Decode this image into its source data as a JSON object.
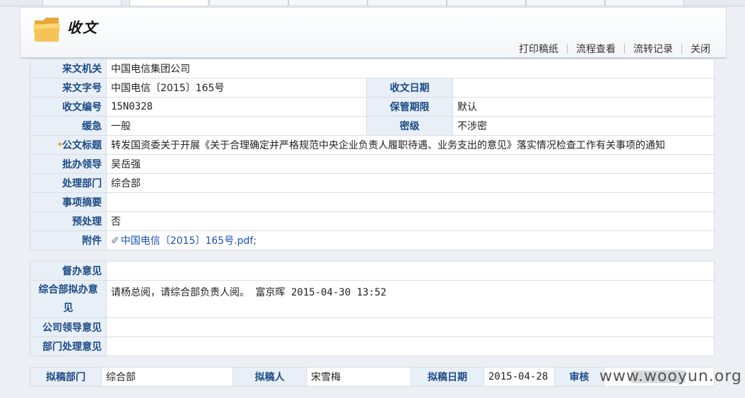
{
  "header": {
    "title": "收文",
    "actions": [
      "打印稿纸",
      "流程查看",
      "流转记录",
      "关闭"
    ]
  },
  "form": {
    "issuer": {
      "label": "来文机关",
      "value": "中国电信集团公司"
    },
    "doc_no": {
      "label": "来文字号",
      "value": "中国电信〔2015〕165号"
    },
    "recv_date": {
      "label": "收文日期",
      "value": ""
    },
    "recv_no": {
      "label": "收文编号",
      "value": "15N0328"
    },
    "retention": {
      "label": "保管期限",
      "value": "默认"
    },
    "urgency": {
      "label": "缓急",
      "value": "一般"
    },
    "secrecy": {
      "label": "密级",
      "value": "不涉密"
    },
    "subject": {
      "required_mark": "*",
      "label": "公文标题",
      "value": "转发国资委关于开展《关于合理确定并严格规范中央企业负责人履职待遇、业务支出的意见》落实情况检查工作有关事项的通知"
    },
    "leader": {
      "label": "批办领导",
      "value": "吴岳强"
    },
    "dept": {
      "label": "处理部门",
      "value": "综合部"
    },
    "summary": {
      "label": "事项摘要",
      "value": ""
    },
    "preprocess": {
      "label": "预处理",
      "value": "否"
    },
    "attachment": {
      "label": "附件",
      "value": "中国电信〔2015〕165号.pdf;"
    }
  },
  "opinions": {
    "supervise": {
      "label": "督办意见",
      "value": ""
    },
    "general_dept": {
      "label_line1": "综合部拟办意",
      "label_line2": "见",
      "value": "请杨总阅，请综合部负责人阅。 富京晖 2015-04-30 13:52"
    },
    "company_leader": {
      "label": "公司领导意见",
      "value": ""
    },
    "dept_handle": {
      "label": "部门处理意见",
      "value": ""
    }
  },
  "draft": {
    "dept_label": "拟稿部门",
    "dept_value": "综合部",
    "person_label": "拟稿人",
    "person_value": "宋雪梅",
    "date_label": "拟稿日期",
    "date_value": "2015-04-28",
    "review_label": "审核",
    "review_value": ""
  },
  "watermark": "www.wooyun.org",
  "icons": {
    "header": "folder-icon",
    "attachment": "paperclip-icon"
  }
}
